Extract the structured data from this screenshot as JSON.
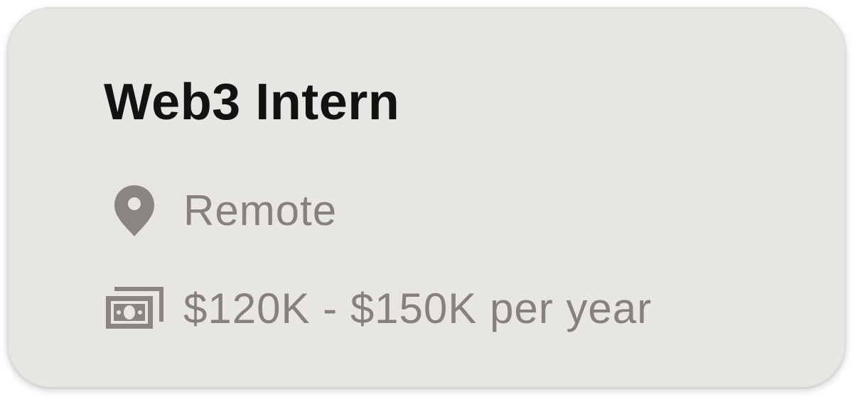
{
  "job": {
    "title": "Web3 Intern",
    "location": {
      "icon": "location-pin-icon",
      "label": "Remote"
    },
    "salary": {
      "icon": "money-bill-icon",
      "label": "$120K - $150K per year"
    }
  },
  "colors": {
    "card_background": "#e7e6e2",
    "title": "#121212",
    "secondary_text": "#86817d",
    "icon": "#8a8580"
  }
}
